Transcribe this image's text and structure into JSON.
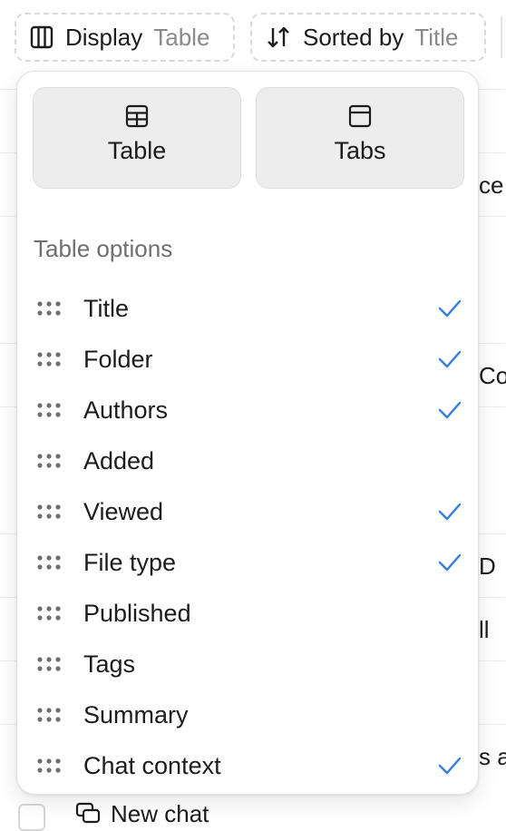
{
  "toolbar": {
    "display_label": "Display",
    "display_value": "Table",
    "sort_label": "Sorted by",
    "sort_value": "Title"
  },
  "background": {
    "row_fragments": [
      "",
      "ce",
      "",
      "Co",
      "",
      "D",
      "ll",
      "",
      "s a"
    ],
    "new_chat_label": "New chat"
  },
  "popover": {
    "modes": [
      {
        "label": "Table",
        "icon": "grid-icon",
        "selected": true
      },
      {
        "label": "Tabs",
        "icon": "tab-window-icon",
        "selected": false
      }
    ],
    "section_title": "Table options",
    "options": [
      {
        "label": "Title",
        "checked": true
      },
      {
        "label": "Folder",
        "checked": true
      },
      {
        "label": "Authors",
        "checked": true
      },
      {
        "label": "Added",
        "checked": false
      },
      {
        "label": "Viewed",
        "checked": true
      },
      {
        "label": "File type",
        "checked": true
      },
      {
        "label": "Published",
        "checked": false
      },
      {
        "label": "Tags",
        "checked": false
      },
      {
        "label": "Summary",
        "checked": false
      },
      {
        "label": "Chat context",
        "checked": true
      }
    ]
  },
  "colors": {
    "accent": "#2f7de1",
    "muted_text": "#8a8a8e",
    "card_bg": "#ededed"
  }
}
